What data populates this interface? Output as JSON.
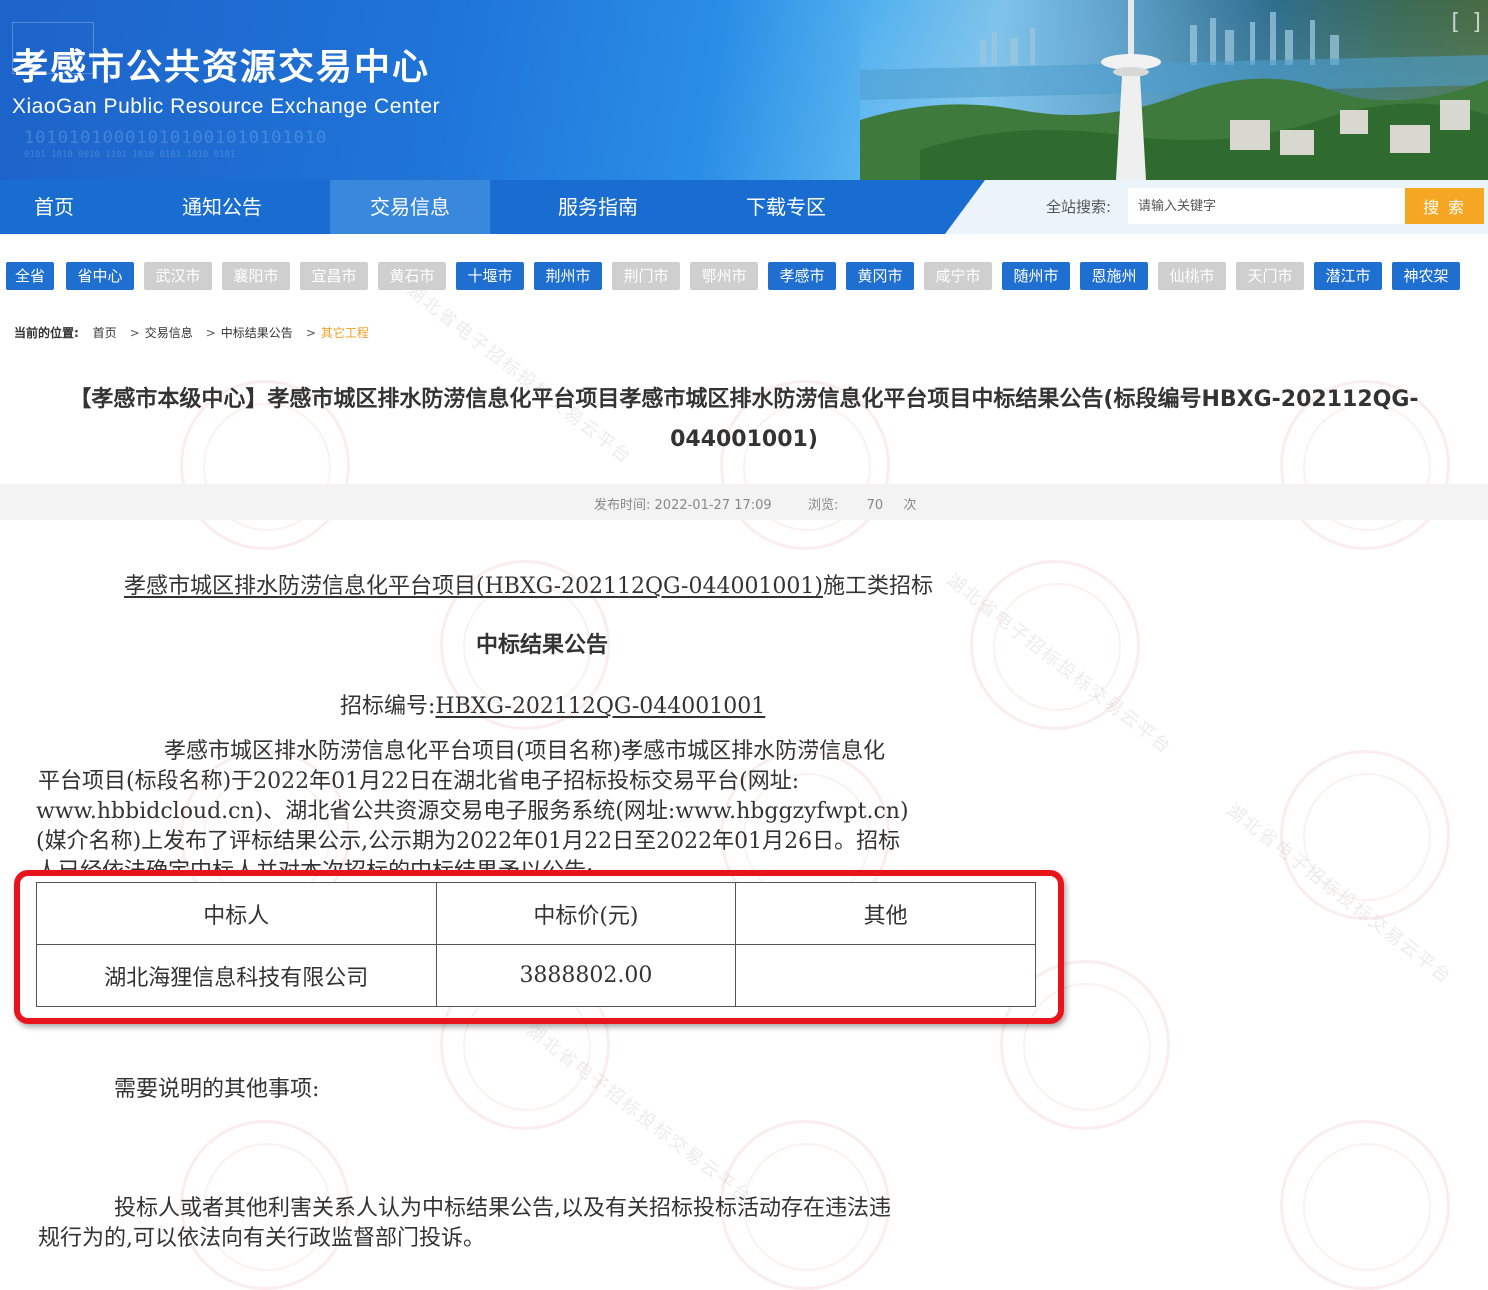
{
  "header": {
    "title_zh": "孝感市公共资源交易中心",
    "title_en": "XiaoGan Public Resource Exchange Center"
  },
  "nav": {
    "items": [
      {
        "label": "首页"
      },
      {
        "label": "通知公告"
      },
      {
        "label": "交易信息"
      },
      {
        "label": "服务指南"
      },
      {
        "label": "下载专区"
      }
    ],
    "active_index": 2,
    "search_label": "全站搜索:",
    "search_placeholder": "请输入关键字",
    "search_button": "搜 索"
  },
  "regions": [
    {
      "label": "全省",
      "style": "blue"
    },
    {
      "label": "省中心",
      "style": "blue"
    },
    {
      "label": "武汉市",
      "style": "grey"
    },
    {
      "label": "襄阳市",
      "style": "grey"
    },
    {
      "label": "宜昌市",
      "style": "grey"
    },
    {
      "label": "黄石市",
      "style": "grey"
    },
    {
      "label": "十堰市",
      "style": "blue"
    },
    {
      "label": "荆州市",
      "style": "blue"
    },
    {
      "label": "荆门市",
      "style": "grey"
    },
    {
      "label": "鄂州市",
      "style": "grey"
    },
    {
      "label": "孝感市",
      "style": "blue"
    },
    {
      "label": "黄冈市",
      "style": "blue"
    },
    {
      "label": "咸宁市",
      "style": "grey"
    },
    {
      "label": "随州市",
      "style": "blue"
    },
    {
      "label": "恩施州",
      "style": "blue"
    },
    {
      "label": "仙桃市",
      "style": "grey"
    },
    {
      "label": "天门市",
      "style": "grey"
    },
    {
      "label": "潜江市",
      "style": "blue"
    },
    {
      "label": "神农架",
      "style": "blue"
    }
  ],
  "breadcrumb": {
    "label": "当前的位置:",
    "items": [
      "首页",
      "交易信息",
      "中标结果公告"
    ],
    "current": "其它工程"
  },
  "article": {
    "title_line1": "【孝感市本级中心】孝感市城区排水防涝信息化平台项目孝感市城区排水防涝信息化平台项目中标结果公告(标段编号HBXG-202112QG-",
    "title_line2": "044001001)",
    "publish_label": "发布时间:",
    "publish_time": "2022-01-27 17:09",
    "views_label": "浏览:",
    "views_count": "70",
    "views_unit": "次",
    "project_name": "孝感市城区排水防涝信息化平台项目(HBXG-202112QG-044001001)",
    "project_suffix": "施工类招标",
    "doc_title": "中标结果公告",
    "bid_no_label": "招标编号:",
    "bid_no": "HBXG-202112QG-044001001",
    "para1": [
      "孝感市城区排水防涝信息化平台项目(项目名称)孝感市城区排水防涝信息化",
      "平台项目(标段名称)于2022年01月22日在湖北省电子招标投标交易平台(网址:",
      "www.hbbidcloud.cn)、湖北省公共资源交易电子服务系统(网址:www.hbggzyfwpt.cn)",
      "(媒介名称)上发布了评标结果公示,公示期为2022年01月22日至2022年01月26日。招标",
      "人已经依法确定中标人并对本次招标的中标结果予以公告:"
    ],
    "table": {
      "headers": [
        "中标人",
        "中标价(元)",
        "其他"
      ],
      "rows": [
        [
          "湖北海狸信息科技有限公司",
          "3888802.00",
          ""
        ]
      ]
    },
    "other_matters": "需要说明的其他事项:",
    "para2": [
      "投标人或者其他利害关系人认为中标结果公告,以及有关招标投标活动存在违法违",
      "规行为的,可以依法向有关行政监督部门投诉。"
    ]
  },
  "watermark_text": "湖北省电子招标投标交易云平台"
}
